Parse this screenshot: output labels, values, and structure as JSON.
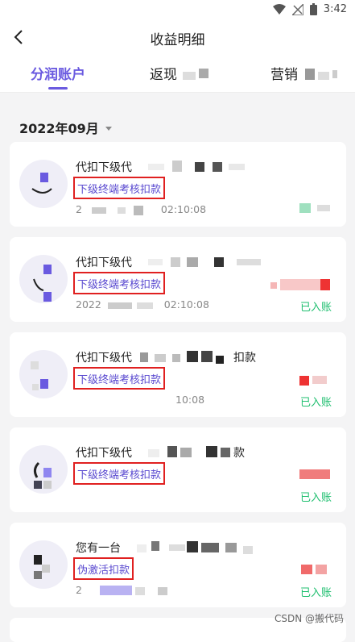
{
  "status_bar": {
    "time": "3:42",
    "icons": [
      "wifi-icon",
      "signal-icon",
      "battery-icon"
    ]
  },
  "header": {
    "title": "收益明细",
    "back_icon": "chevron-left-icon"
  },
  "tabs": [
    {
      "label": "分润账户",
      "active": true
    },
    {
      "label": "返现",
      "active": false
    },
    {
      "label": "营销",
      "active": false
    }
  ],
  "month": {
    "label": "2022年09月",
    "dropdown_icon": "caret-down-icon"
  },
  "records": [
    {
      "title": "代扣下级代",
      "subtitle": "下级终端考核扣款",
      "time": "2",
      "time_tail": "02:10:08",
      "status": ""
    },
    {
      "title": "代扣下级代",
      "subtitle": "下级终端考核扣款",
      "time": "2022",
      "time_tail": "02:10:08",
      "status": "已入账"
    },
    {
      "title": "代扣下级代",
      "title_tail": "扣款",
      "subtitle": "下级终端考核扣款",
      "time": "",
      "time_tail": "10:08",
      "status": "已入账"
    },
    {
      "title": "代扣下级代",
      "title_tail": "款",
      "subtitle": "下级终端考核扣款",
      "time": "",
      "time_tail": "",
      "status": "已入账"
    },
    {
      "title": "您有一台",
      "subtitle": "伪激活扣款",
      "time": "2",
      "time_tail": "",
      "status": "已入账"
    }
  ],
  "colors": {
    "accent": "#6a5ae0",
    "highlight_box": "#e02020",
    "status_green": "#1fbf6f"
  },
  "watermark": "CSDN @搬代码"
}
